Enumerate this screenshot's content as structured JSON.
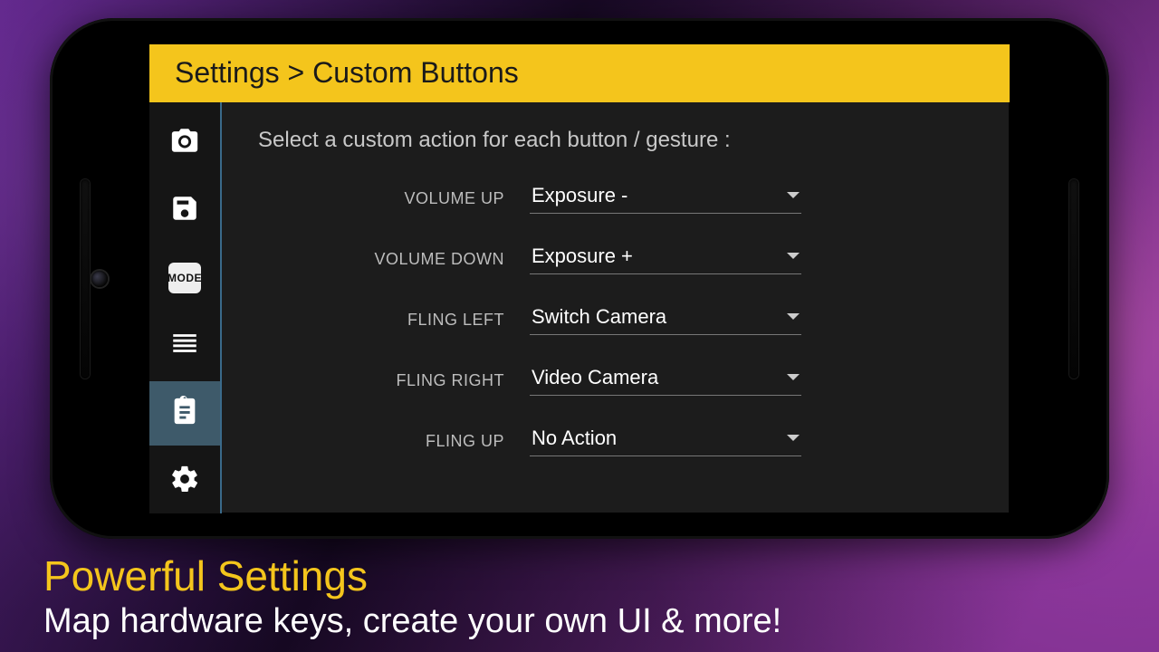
{
  "header": {
    "breadcrumb": "Settings > Custom Buttons"
  },
  "sidebar": {
    "items": [
      {
        "name": "camera-icon"
      },
      {
        "name": "save-icon"
      },
      {
        "name": "mode-icon",
        "label": "MODE"
      },
      {
        "name": "list-icon"
      },
      {
        "name": "clipboard-icon"
      },
      {
        "name": "gear-icon"
      }
    ],
    "active_index": 4
  },
  "content": {
    "instruction": "Select a custom action for each button / gesture :",
    "rows": [
      {
        "label": "VOLUME UP",
        "value": "Exposure -"
      },
      {
        "label": "VOLUME DOWN",
        "value": "Exposure +"
      },
      {
        "label": "FLING LEFT",
        "value": "Switch Camera"
      },
      {
        "label": "FLING RIGHT",
        "value": "Video Camera"
      },
      {
        "label": "FLING UP",
        "value": "No Action"
      }
    ]
  },
  "caption": {
    "title": "Powerful Settings",
    "subtitle": "Map hardware keys, create your own UI & more!"
  }
}
